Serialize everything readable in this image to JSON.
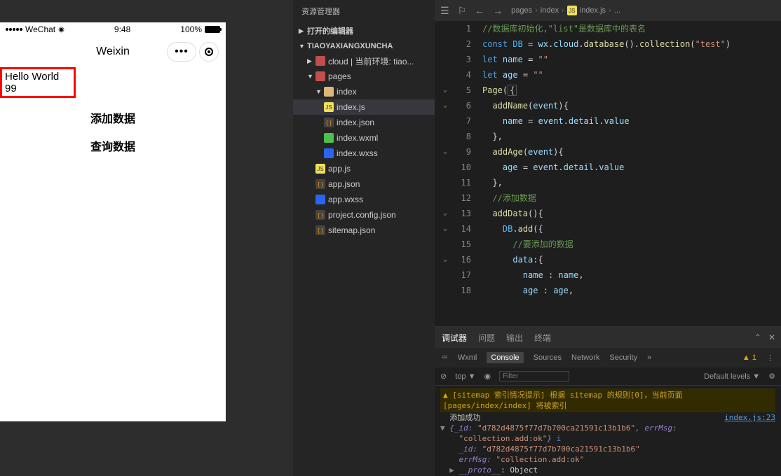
{
  "simulator": {
    "carrier": "WeChat",
    "time": "9:48",
    "battery": "100%",
    "navTitle": "Weixin",
    "helloText": "Hello World",
    "numText": "99",
    "btn1": "添加数据",
    "btn2": "查询数据"
  },
  "explorer": {
    "title": "资源管理器",
    "section1": "打开的编辑器",
    "section2": "TIAOYAXIANGXUNCHA",
    "items": {
      "cloud": "cloud | 当前环境: tiao...",
      "pages": "pages",
      "index": "index",
      "indexjs": "index.js",
      "indexjson": "index.json",
      "indexwxml": "index.wxml",
      "indexwxss": "index.wxss",
      "appjs": "app.js",
      "appjson": "app.json",
      "appwxss": "app.wxss",
      "projconfig": "project.config.json",
      "sitemap": "sitemap.json"
    }
  },
  "editor": {
    "breadcrumb": {
      "p1": "pages",
      "p2": "index",
      "p3": "index.js",
      "p4": "..."
    },
    "lines": [
      {
        "n": "1",
        "html": "<span class='c-comment'>//数据库初始化,\"list\"是数据库中的表名</span>"
      },
      {
        "n": "2",
        "html": "<span class='c-keyword'>const</span> <span class='c-const'>DB</span> <span class='c-punct'>=</span> <span class='c-prop'>wx</span><span class='c-punct'>.</span><span class='c-prop'>cloud</span><span class='c-punct'>.</span><span class='c-func'>database</span><span class='c-punct'>().</span><span class='c-func'>collection</span><span class='c-punct'>(</span><span class='c-string'>\"test\"</span><span class='c-punct'>)</span>"
      },
      {
        "n": "3",
        "html": "<span class='c-keyword'>let</span> <span class='c-prop'>name</span> <span class='c-punct'>=</span> <span class='c-string'>\"\"</span>"
      },
      {
        "n": "4",
        "html": "<span class='c-keyword'>let</span> <span class='c-prop'>age</span> <span class='c-punct'>=</span> <span class='c-string'>\"\"</span>"
      },
      {
        "n": "5",
        "html": "<span class='c-func'>Page</span><span class='c-punct'>(</span><span class='boxed'>{</span>",
        "fold": "v"
      },
      {
        "n": "6",
        "html": "  <span class='c-func'>addName</span><span class='c-punct'>(</span><span class='c-prop'>event</span><span class='c-punct'>){</span>",
        "fold": "v"
      },
      {
        "n": "7",
        "html": "    <span class='c-prop'>name</span> <span class='c-punct'>=</span> <span class='c-prop'>event</span><span class='c-punct'>.</span><span class='c-prop'>detail</span><span class='c-punct'>.</span><span class='c-prop'>value</span>"
      },
      {
        "n": "8",
        "html": "  <span class='c-punct'>},</span>"
      },
      {
        "n": "9",
        "html": "  <span class='c-func'>addAge</span><span class='c-punct'>(</span><span class='c-prop'>event</span><span class='c-punct'>){</span>",
        "fold": "v"
      },
      {
        "n": "10",
        "html": "    <span class='c-prop'>age</span> <span class='c-punct'>=</span> <span class='c-prop'>event</span><span class='c-punct'>.</span><span class='c-prop'>detail</span><span class='c-punct'>.</span><span class='c-prop'>value</span>"
      },
      {
        "n": "11",
        "html": "  <span class='c-punct'>},</span>"
      },
      {
        "n": "12",
        "html": "  <span class='c-comment'>//添加数据</span>"
      },
      {
        "n": "13",
        "html": "  <span class='c-func'>addData</span><span class='c-punct'>(){</span>",
        "fold": "v"
      },
      {
        "n": "14",
        "html": "    <span class='c-const'>DB</span><span class='c-punct'>.</span><span class='c-func'>add</span><span class='c-punct'>({</span>",
        "fold": "v"
      },
      {
        "n": "15",
        "html": "      <span class='c-comment'>//要添加的数据</span>"
      },
      {
        "n": "16",
        "html": "      <span class='c-prop'>data</span><span class='c-punct'>:{</span>",
        "fold": "v"
      },
      {
        "n": "17",
        "html": "        <span class='c-prop'>name</span> <span class='c-punct'>:</span> <span class='c-prop'>name</span><span class='c-punct'>,</span>"
      },
      {
        "n": "18",
        "html": "        <span class='c-prop'>age</span> <span class='c-punct'>:</span> <span class='c-prop'>age</span><span class='c-punct'>,</span>"
      }
    ]
  },
  "debugger": {
    "tabs": {
      "t1": "调试器",
      "t2": "问题",
      "t3": "输出",
      "t4": "终端"
    },
    "subTabs": {
      "wxml": "Wxml",
      "console": "Console",
      "sources": "Sources",
      "network": "Network",
      "security": "Security"
    },
    "warnCount": "1",
    "toolbar": {
      "top": "top",
      "filter": "Filter",
      "levels": "Default levels"
    },
    "console": {
      "warn": "[sitemap 索引情况提示] 根据 sitemap 的规则[0]，当前页面 [pages/index/index] 将被索引",
      "success": "添加成功",
      "link": "index.js:23",
      "obj1_open": "{_id: ",
      "obj1_id": "\"d782d4875f77d7b700ca21591c13b1b6\"",
      "obj1_mid": ", errMsg: ",
      "obj1_msg": "\"collection.add:ok\"",
      "obj1_close": "}",
      "infoBadge": "i",
      "line_id_key": "_id: ",
      "line_id_val": "\"d782d4875f77d7b700ca21591c13b1b6\"",
      "line_err_key": "errMsg: ",
      "line_err_val": "\"collection.add:ok\"",
      "proto": "__proto__",
      "protoVal": ": Object"
    }
  }
}
